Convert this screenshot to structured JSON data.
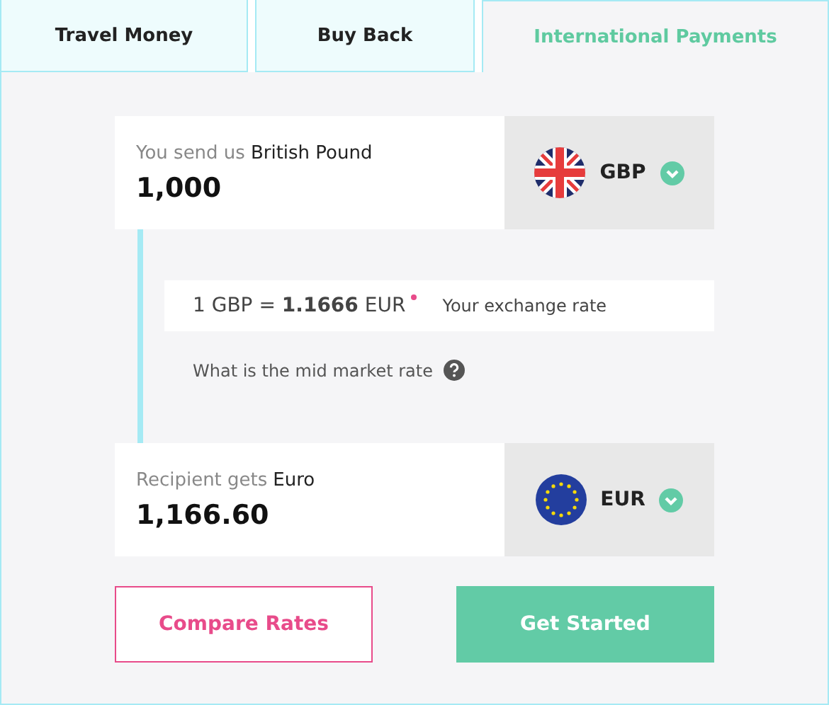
{
  "tabs": [
    {
      "label": "Travel Money",
      "selected": false
    },
    {
      "label": "Buy Back",
      "selected": false
    },
    {
      "label": "International Payments",
      "selected": true
    }
  ],
  "send": {
    "label": "You send us",
    "currency_name": "British Pound",
    "amount": "1,000",
    "code": "GBP",
    "kind": "uk"
  },
  "rate": {
    "text": "1 GBP = **1.1666** EUR",
    "note": "Your exchange rate"
  },
  "mid_market": {
    "text": "What is the mid market rate"
  },
  "receive": {
    "label": "Recipient gets",
    "currency_name": "Euro",
    "amount": "1,166.60",
    "code": "EUR",
    "kind": "eu"
  },
  "buttons": [
    {
      "label": "Compare Rates",
      "kind": "outline"
    },
    {
      "label": "Get Started",
      "kind": "primary"
    }
  ]
}
